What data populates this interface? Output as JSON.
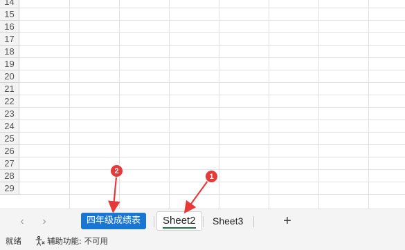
{
  "row_numbers": [
    "14",
    "15",
    "16",
    "17",
    "18",
    "19",
    "20",
    "21",
    "22",
    "23",
    "24",
    "25",
    "26",
    "27",
    "28",
    "29"
  ],
  "sheet_tabs": [
    {
      "label": "四年级成绩表",
      "state": "highlighted"
    },
    {
      "label": "Sheet2",
      "state": "active"
    },
    {
      "label": "Sheet3",
      "state": "normal"
    }
  ],
  "tabbar": {
    "prev_icon": "chevron-left-icon",
    "next_icon": "chevron-right-icon",
    "add_icon": "plus-icon",
    "add_glyph": "+"
  },
  "status_bar": {
    "ready_text": "就绪",
    "accessibility_text": "辅助功能: 不可用",
    "accessibility_icon": "accessibility-icon"
  },
  "annotations": [
    {
      "number": "1",
      "points_to": "Sheet2"
    },
    {
      "number": "2",
      "points_to": "四年级成绩表"
    }
  ],
  "colors": {
    "highlight_tab": "#1976d2",
    "active_underline": "#1e7145",
    "annotation_red": "#e63a3a"
  }
}
